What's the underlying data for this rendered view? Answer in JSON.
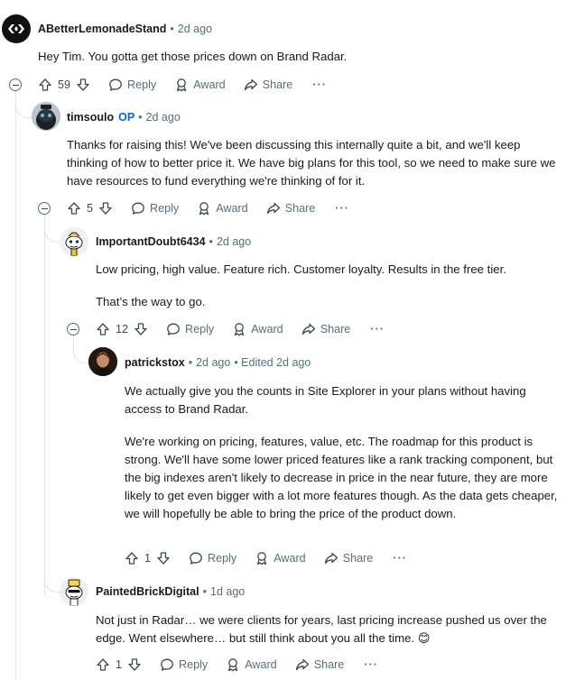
{
  "comments": [
    {
      "author": "ABetterLemonadeStand",
      "op_badge": "",
      "sep": "•",
      "time": "2d ago",
      "edited": "",
      "paragraphs": [
        "Hey Tim. You gotta get those prices down on Brand Radar."
      ],
      "score": "59",
      "reply_label": "Reply",
      "award_label": "Award",
      "share_label": "Share",
      "more_label": "···"
    },
    {
      "author": "timsoulo",
      "op_badge": "OP",
      "sep": "•",
      "time": "2d ago",
      "edited": "",
      "paragraphs": [
        "Thanks for raising this! We've been discussing this internally quite a bit, and we'll keep thinking of how to better price it. We have big plans for this tool, so we need to make sure we have resources to fund everything we're thinking of for it."
      ],
      "score": "5",
      "reply_label": "Reply",
      "award_label": "Award",
      "share_label": "Share",
      "more_label": "···"
    },
    {
      "author": "ImportantDoubt6434",
      "op_badge": "",
      "sep": "•",
      "time": "2d ago",
      "edited": "",
      "paragraphs": [
        "Low pricing, high value. Feature rich. Customer loyalty. Results in the free tier.",
        "That’s the way to go."
      ],
      "score": "12",
      "reply_label": "Reply",
      "award_label": "Award",
      "share_label": "Share",
      "more_label": "···"
    },
    {
      "author": "patrickstox",
      "op_badge": "",
      "sep": "•",
      "time": "2d ago",
      "edited": "• Edited 2d ago",
      "paragraphs": [
        "We actually give you the counts in Site Explorer in your plans without having access to Brand Radar.",
        "We're working on pricing, features, value, etc. The roadmap for this product is strong. We'll have some lower priced features like a rank tracking component, but the big indexes aren't likely to decrease in price in the near future, they are more likely to get even bigger with a lot more features though. As the data gets cheaper, we will hopefully be able to bring the price of the product down."
      ],
      "score": "1",
      "reply_label": "Reply",
      "award_label": "Award",
      "share_label": "Share",
      "more_label": "···"
    },
    {
      "author": "PaintedBrickDigital",
      "op_badge": "",
      "sep": "•",
      "time": "1d ago",
      "edited": "",
      "paragraphs": [
        "Not just in Radar… we were clients for years, last pricing increase pushed us over the edge. Went elsewhere… but still think about you all the time. 😊"
      ],
      "score": "1",
      "reply_label": "Reply",
      "award_label": "Award",
      "share_label": "Share",
      "more_label": "···"
    }
  ],
  "icons": {
    "upvote": "upvote-arrow-icon",
    "downvote": "downvote-arrow-icon",
    "reply": "speech-bubble-icon",
    "award": "award-ribbon-icon",
    "share": "share-arrow-icon",
    "collapse": "minus-circle-icon"
  },
  "colors": {
    "meta_text": "#576f76",
    "op_badge": "#0a66c2",
    "thread_line": "#e0e3e6",
    "text": "#1a1a1b"
  }
}
